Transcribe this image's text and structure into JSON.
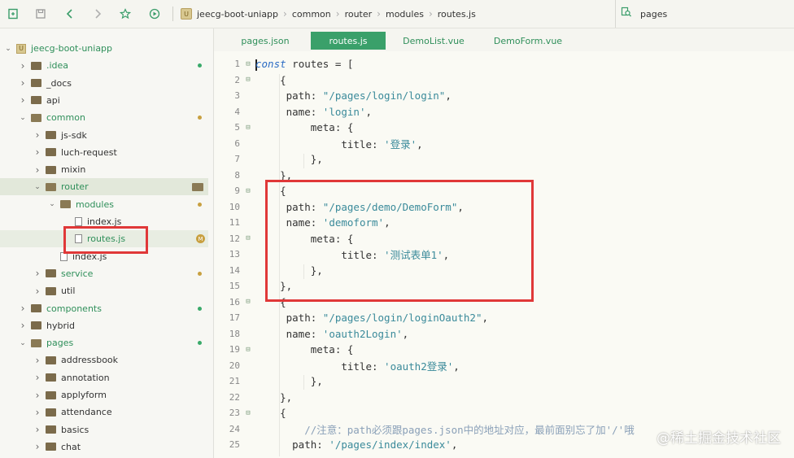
{
  "toolbar": {
    "breadcrumb": [
      "jeecg-boot-uniapp",
      "common",
      "router",
      "modules",
      "routes.js"
    ],
    "search_value": "pages"
  },
  "sidebar": {
    "items": [
      {
        "label": "jeecg-boot-uniapp",
        "depth": 0,
        "kind": "project",
        "open": true,
        "status": ""
      },
      {
        "label": ".idea",
        "depth": 1,
        "kind": "folder",
        "open": false,
        "status": "green"
      },
      {
        "label": "_docs",
        "depth": 1,
        "kind": "folder",
        "open": false,
        "status": ""
      },
      {
        "label": "api",
        "depth": 1,
        "kind": "folder",
        "open": false,
        "status": ""
      },
      {
        "label": "common",
        "depth": 1,
        "kind": "folder",
        "open": true,
        "status": "orange"
      },
      {
        "label": "js-sdk",
        "depth": 2,
        "kind": "folder",
        "open": false,
        "status": ""
      },
      {
        "label": "luch-request",
        "depth": 2,
        "kind": "folder",
        "open": false,
        "status": ""
      },
      {
        "label": "mixin",
        "depth": 2,
        "kind": "folder",
        "open": false,
        "status": ""
      },
      {
        "label": "router",
        "depth": 2,
        "kind": "folder",
        "open": true,
        "status": "folder"
      },
      {
        "label": "modules",
        "depth": 3,
        "kind": "folder",
        "open": true,
        "status": "orange"
      },
      {
        "label": "index.js",
        "depth": 4,
        "kind": "file",
        "open": false,
        "status": ""
      },
      {
        "label": "routes.js",
        "depth": 4,
        "kind": "file",
        "open": false,
        "status": "M"
      },
      {
        "label": "index.js",
        "depth": 3,
        "kind": "file",
        "open": false,
        "status": ""
      },
      {
        "label": "service",
        "depth": 2,
        "kind": "folder",
        "open": false,
        "status": "orange"
      },
      {
        "label": "util",
        "depth": 2,
        "kind": "folder",
        "open": false,
        "status": ""
      },
      {
        "label": "components",
        "depth": 1,
        "kind": "folder",
        "open": false,
        "status": "green"
      },
      {
        "label": "hybrid",
        "depth": 1,
        "kind": "folder",
        "open": false,
        "status": ""
      },
      {
        "label": "pages",
        "depth": 1,
        "kind": "folder",
        "open": true,
        "status": "green"
      },
      {
        "label": "addressbook",
        "depth": 2,
        "kind": "folder",
        "open": false,
        "status": ""
      },
      {
        "label": "annotation",
        "depth": 2,
        "kind": "folder",
        "open": false,
        "status": ""
      },
      {
        "label": "applyform",
        "depth": 2,
        "kind": "folder",
        "open": false,
        "status": ""
      },
      {
        "label": "attendance",
        "depth": 2,
        "kind": "folder",
        "open": false,
        "status": ""
      },
      {
        "label": "basics",
        "depth": 2,
        "kind": "folder",
        "open": false,
        "status": ""
      },
      {
        "label": "chat",
        "depth": 2,
        "kind": "folder",
        "open": false,
        "status": ""
      }
    ]
  },
  "tabs": [
    {
      "label": "pages.json",
      "active": false
    },
    {
      "label": "routes.js",
      "active": true
    },
    {
      "label": "DemoList.vue",
      "active": false
    },
    {
      "label": "DemoForm.vue",
      "active": false
    }
  ],
  "editor": {
    "lines": [
      {
        "n": "1",
        "fold": true,
        "tokens": [
          {
            "t": "const",
            "c": "kw"
          },
          {
            "t": " routes = [",
            "c": ""
          }
        ]
      },
      {
        "n": "2",
        "fold": true,
        "tokens": [
          {
            "t": "    {",
            "c": ""
          }
        ]
      },
      {
        "n": "3",
        "fold": false,
        "tokens": [
          {
            "t": "     path: ",
            "c": ""
          },
          {
            "t": "\"/pages/login/login\"",
            "c": "str"
          },
          {
            "t": ",",
            "c": ""
          }
        ]
      },
      {
        "n": "4",
        "fold": false,
        "tokens": [
          {
            "t": "     name: ",
            "c": ""
          },
          {
            "t": "'login'",
            "c": "str"
          },
          {
            "t": ",",
            "c": ""
          }
        ]
      },
      {
        "n": "5",
        "fold": true,
        "tokens": [
          {
            "t": "         meta: {",
            "c": ""
          }
        ]
      },
      {
        "n": "6",
        "fold": false,
        "tokens": [
          {
            "t": "              title: ",
            "c": ""
          },
          {
            "t": "'登录'",
            "c": "str"
          },
          {
            "t": ",",
            "c": ""
          }
        ]
      },
      {
        "n": "7",
        "fold": false,
        "tokens": [
          {
            "t": "         },",
            "c": ""
          }
        ]
      },
      {
        "n": "8",
        "fold": false,
        "tokens": [
          {
            "t": "    },",
            "c": ""
          }
        ]
      },
      {
        "n": "9",
        "fold": true,
        "tokens": [
          {
            "t": "    {",
            "c": ""
          }
        ]
      },
      {
        "n": "10",
        "fold": false,
        "tokens": [
          {
            "t": "     path: ",
            "c": ""
          },
          {
            "t": "\"/pages/demo/DemoForm\"",
            "c": "str"
          },
          {
            "t": ",",
            "c": ""
          }
        ]
      },
      {
        "n": "11",
        "fold": false,
        "tokens": [
          {
            "t": "     name: ",
            "c": ""
          },
          {
            "t": "'demoform'",
            "c": "str"
          },
          {
            "t": ",",
            "c": ""
          }
        ]
      },
      {
        "n": "12",
        "fold": true,
        "tokens": [
          {
            "t": "         meta: {",
            "c": ""
          }
        ]
      },
      {
        "n": "13",
        "fold": false,
        "tokens": [
          {
            "t": "              title: ",
            "c": ""
          },
          {
            "t": "'测试表单1'",
            "c": "str"
          },
          {
            "t": ",",
            "c": ""
          }
        ]
      },
      {
        "n": "14",
        "fold": false,
        "tokens": [
          {
            "t": "         },",
            "c": ""
          }
        ]
      },
      {
        "n": "15",
        "fold": false,
        "tokens": [
          {
            "t": "    },",
            "c": ""
          }
        ]
      },
      {
        "n": "16",
        "fold": true,
        "tokens": [
          {
            "t": "    {",
            "c": ""
          }
        ]
      },
      {
        "n": "17",
        "fold": false,
        "tokens": [
          {
            "t": "     path: ",
            "c": ""
          },
          {
            "t": "\"/pages/login/loginOauth2\"",
            "c": "str"
          },
          {
            "t": ",",
            "c": ""
          }
        ]
      },
      {
        "n": "18",
        "fold": false,
        "tokens": [
          {
            "t": "     name: ",
            "c": ""
          },
          {
            "t": "'oauth2Login'",
            "c": "str"
          },
          {
            "t": ",",
            "c": ""
          }
        ]
      },
      {
        "n": "19",
        "fold": true,
        "tokens": [
          {
            "t": "         meta: {",
            "c": ""
          }
        ]
      },
      {
        "n": "20",
        "fold": false,
        "tokens": [
          {
            "t": "              title: ",
            "c": ""
          },
          {
            "t": "'oauth2登录'",
            "c": "str"
          },
          {
            "t": ",",
            "c": ""
          }
        ]
      },
      {
        "n": "21",
        "fold": false,
        "tokens": [
          {
            "t": "         },",
            "c": ""
          }
        ]
      },
      {
        "n": "22",
        "fold": false,
        "tokens": [
          {
            "t": "    },",
            "c": ""
          }
        ]
      },
      {
        "n": "23",
        "fold": true,
        "tokens": [
          {
            "t": "    {",
            "c": ""
          }
        ]
      },
      {
        "n": "24",
        "fold": false,
        "tokens": [
          {
            "t": "        //注意：path必须跟pages.json中的地址对应，最前面别忘了加'/'哦",
            "c": "cmt"
          }
        ]
      },
      {
        "n": "25",
        "fold": false,
        "tokens": [
          {
            "t": "      path: ",
            "c": ""
          },
          {
            "t": "'/pages/index/index'",
            "c": "str"
          },
          {
            "t": ",",
            "c": ""
          }
        ]
      }
    ]
  },
  "watermark": "@稀土掘金技术社区",
  "colors": {
    "accent_green": "#3aa06a",
    "annotation_red": "#e03838",
    "keyword_blue": "#2b6cc4",
    "string_teal": "#3a8a9a"
  }
}
